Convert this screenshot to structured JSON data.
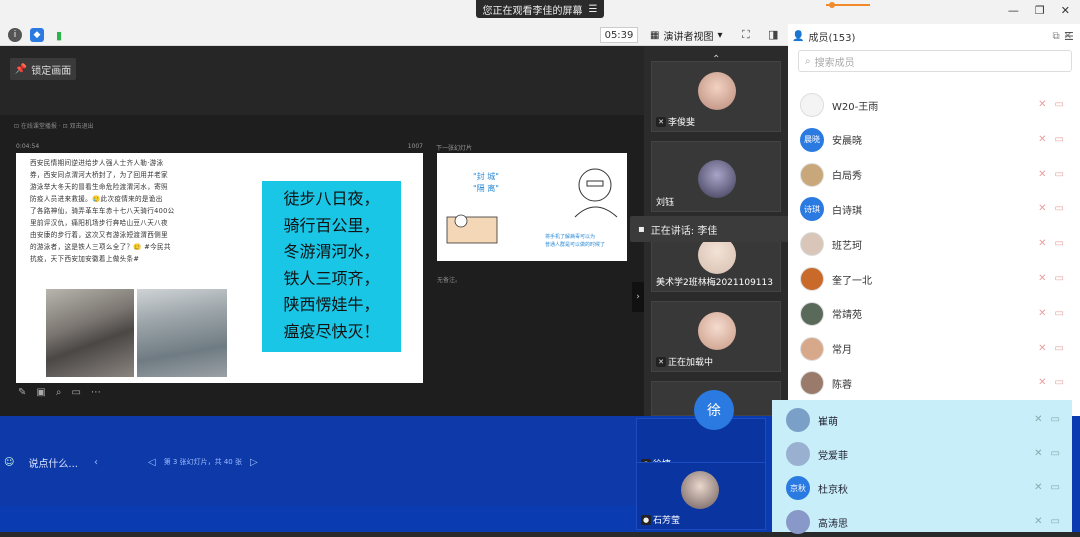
{
  "banner": {
    "text": "您正在观看李佳的屏幕",
    "icon": "menu-icon"
  },
  "window": {
    "minimize": "—",
    "restore": "❐",
    "close": "✕"
  },
  "toolbar": {
    "timer": "05:39",
    "view_label": "演讲者视图",
    "icons": [
      "info-icon",
      "shield-icon",
      "signal-icon"
    ]
  },
  "stage": {
    "lock_label": "锁定画面"
  },
  "presentation": {
    "top_text": "⊡ 在线课堂播报 ·  ⊡ 双击退出",
    "slide_time": "0:04:54",
    "slide_count": "1007",
    "next_label": "下一张幻灯片",
    "notes_label": "无备注。",
    "poem_lines": [
      "西安民情期间逆进给步人强人士齐人勒·游泳",
      "券，西安同点渭河大桥封了，为了回用并老家",
      "游泳举大冬天的冒看生命危险渡渭河水，寄照",
      "防疫人员进来救援。🥲此次疫情来的是诡出",
      "了各路神仙，骑弄革车车赤十七八天骑行400公",
      "里前评汉仇，痛阳机场步行奔哈山豆八天八夜",
      "由安康的步行着，这次又有游泳短渡渭西侧里",
      "的游泳者，这是铁人三项么全了？🥲 #今民共",
      "抗疫，天下西安加安徽着上做头条#"
    ],
    "cyan_lines": [
      "徒步八日夜，",
      "骑行百公里，",
      "冬游渭河水，",
      "铁人三项齐，",
      "陕西愣娃牛，",
      "瘟疫尽快灭！"
    ],
    "next_slide": {
      "line1": "\"封 城\"",
      "line2": "\"隔 离\"",
      "caption1": "将手机了解病毒可以为",
      "caption2": "普通人群是可以做的时候了"
    }
  },
  "tiles": [
    {
      "name": "李俊斐",
      "muted": true
    },
    {
      "name": "刘钰",
      "muted": false
    },
    {
      "name": "美术学2班林梅2021109113",
      "muted": false
    },
    {
      "name": "正在加载中",
      "muted": true
    }
  ],
  "speaking": {
    "label": "正在讲话: 李佳"
  },
  "panel": {
    "title": "成员(153)",
    "search_placeholder": "搜索成员",
    "members": [
      {
        "name": "W20-王雨",
        "avatar": "",
        "color": "#f4f4f4"
      },
      {
        "name": "安晨晓",
        "avatar": "晨晓",
        "color": "#2a7ae2"
      },
      {
        "name": "白局秀",
        "avatar": "",
        "color": "#c8a87a"
      },
      {
        "name": "白诗琪",
        "avatar": "诗琪",
        "color": "#2a7ae2"
      },
      {
        "name": "班艺珂",
        "avatar": "",
        "color": "#d9c6b8"
      },
      {
        "name": "奎了一北",
        "avatar": "",
        "color": "#c96a2a"
      },
      {
        "name": "常靖苑",
        "avatar": "",
        "color": "#5a6a5a"
      },
      {
        "name": "常月",
        "avatar": "",
        "color": "#d8a88a"
      },
      {
        "name": "陈蓉",
        "avatar": "",
        "color": "#9a7a6a"
      }
    ]
  },
  "bottom": {
    "chat_placeholder": "说点什么...",
    "slide_pos": "第 3 张幻灯片，共 40 张",
    "tile_names": [
      "徐婕",
      "石芳莹"
    ],
    "overlay_avatar": "徐",
    "members": [
      {
        "name": "崔萌",
        "avatar": "",
        "color": "#7aa0c8"
      },
      {
        "name": "党爱菲",
        "avatar": "",
        "color": "#9ab0d0"
      },
      {
        "name": "杜京秋",
        "avatar": "京秋",
        "color": "#2a7ae2"
      },
      {
        "name": "高涛思",
        "avatar": "",
        "color": "#8898c8"
      }
    ]
  }
}
